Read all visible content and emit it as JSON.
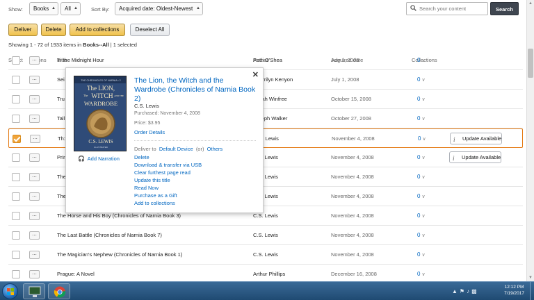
{
  "filters": {
    "show_label": "Show:",
    "show_value": "Books",
    "scope_value": "All",
    "sort_label": "Sort By:",
    "sort_value": "Acquired date: Oldest-Newest"
  },
  "search": {
    "placeholder": "Search your content",
    "button_label": "Search"
  },
  "actions": {
    "deliver": "Deliver",
    "delete": "Delete",
    "add_to_collections": "Add to collections",
    "deselect_all": "Deselect All"
  },
  "showing": {
    "prefix": "Showing 1 - 72 of 1933 items in",
    "scope": "Books--All",
    "suffix": "| 1 selected"
  },
  "columns": {
    "select": "Select",
    "actions": "Actions",
    "title": "Title",
    "author": "Author",
    "acquired": "Acquired date",
    "collections": "Collections"
  },
  "rows": [
    {
      "title": "In the Midnight Hour",
      "author": "Patti O'Shea",
      "date": "July 1, 2008",
      "collections": "0",
      "selected": false,
      "update": false
    },
    {
      "title": "Sei",
      "author": "Sherrilyn Kenyon",
      "date": "July 1, 2008",
      "collections": "0",
      "selected": false,
      "update": false
    },
    {
      "title": "Tru",
      "author": "Oprah Winfree",
      "date": "October 15, 2008",
      "collections": "0",
      "selected": false,
      "update": false
    },
    {
      "title": "Tall",
      "author": "Joseph Walker",
      "date": "October 27, 2008",
      "collections": "0",
      "selected": false,
      "update": false
    },
    {
      "title": "Th:",
      "author": "C.S. Lewis",
      "date": "November 4, 2008",
      "collections": "0",
      "selected": true,
      "update": true
    },
    {
      "title": "Prir",
      "author": "C.S. Lewis",
      "date": "November 4, 2008",
      "collections": "0",
      "selected": false,
      "update": true
    },
    {
      "title": "The",
      "author": "C.S. Lewis",
      "date": "November 4, 2008",
      "collections": "0",
      "selected": false,
      "update": false
    },
    {
      "title": "The",
      "author": "C.S. Lewis",
      "date": "November 4, 2008",
      "collections": "0",
      "selected": false,
      "update": false
    },
    {
      "title": "The Horse and His Boy (Chronicles of Narnia Book 3)",
      "author": "C.S. Lewis",
      "date": "November 4, 2008",
      "collections": "0",
      "selected": false,
      "update": false
    },
    {
      "title": "The Last Battle (Chronicles of Narnia Book 7)",
      "author": "C.S. Lewis",
      "date": "November 4, 2008",
      "collections": "0",
      "selected": false,
      "update": false
    },
    {
      "title": "The Magician's Nephew (Chronicles of Narnia Book 1)",
      "author": "C.S. Lewis",
      "date": "November 4, 2008",
      "collections": "0",
      "selected": false,
      "update": false
    },
    {
      "title": "Prague: A Novel",
      "author": "Arthur Phillips",
      "date": "December 16, 2008",
      "collections": "0",
      "selected": false,
      "update": false
    }
  ],
  "update_label": "Update Available",
  "popover": {
    "title": "The Lion, the Witch and the Wardrobe (Chronicles of Narnia Book 2)",
    "author": "C.S. Lewis",
    "purchased": "Purchased: November 4, 2008",
    "price": "Price: $3.95",
    "order_details": "Order Details",
    "add_narration": "Add Narration",
    "deliver_to": "Deliver to",
    "default_device": "Default Device",
    "or": "(or)",
    "others": "Others",
    "links": [
      "Delete",
      "Download & transfer via USB",
      "Clear furthest page read",
      "Update this title",
      "Read Now",
      "Purchase as a Gift",
      "Add to collections"
    ],
    "cover": {
      "series": "THE CHRONICLES OF NARNIA • 2",
      "title_line1": "The LION,",
      "title_line2": "WITCH",
      "title_line3": "WARDROBE",
      "the_small": "The",
      "and_the": "AND THE",
      "author": "C.S. LEWIS",
      "illustrator": "ILLUSTRATED"
    }
  },
  "taskbar": {
    "time": "12:12 PM",
    "date": "7/19/2017"
  },
  "colors": {
    "accent_orange": "#e47911",
    "link_blue": "#0066c0",
    "button_yellow": "#f0c14b",
    "search_button": "#3f4650"
  }
}
